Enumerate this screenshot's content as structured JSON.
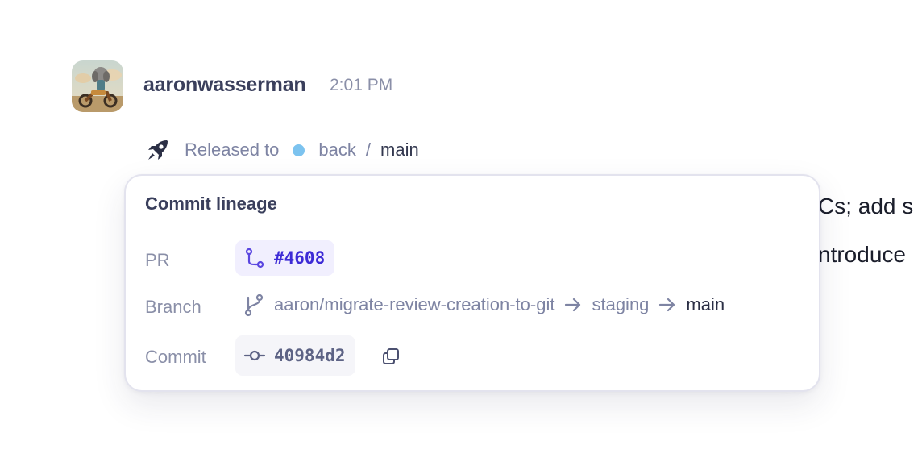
{
  "message": {
    "author": "aaronwasserman",
    "time": "2:01 PM",
    "avatar_icon": "avatar-dog-on-motorcycle",
    "background_text": [
      "Cs; add s",
      "ntroduce"
    ]
  },
  "release": {
    "icon": "rocket-icon",
    "label": "Released to",
    "env_color": "#7cc3ef",
    "env": "back",
    "separator": "/",
    "branch": "main"
  },
  "lineage": {
    "title": "Commit lineage",
    "pr": {
      "label": "PR",
      "icon": "pull-request-icon",
      "number": "#4608",
      "color": "#3d2bd6"
    },
    "branch": {
      "label": "Branch",
      "icon": "git-branch-icon",
      "path": [
        "aaron/migrate-review-creation-to-git",
        "staging",
        "main"
      ]
    },
    "commit": {
      "label": "Commit",
      "icon": "git-commit-icon",
      "hash": "40984d2",
      "copy_icon": "copy-icon"
    }
  }
}
